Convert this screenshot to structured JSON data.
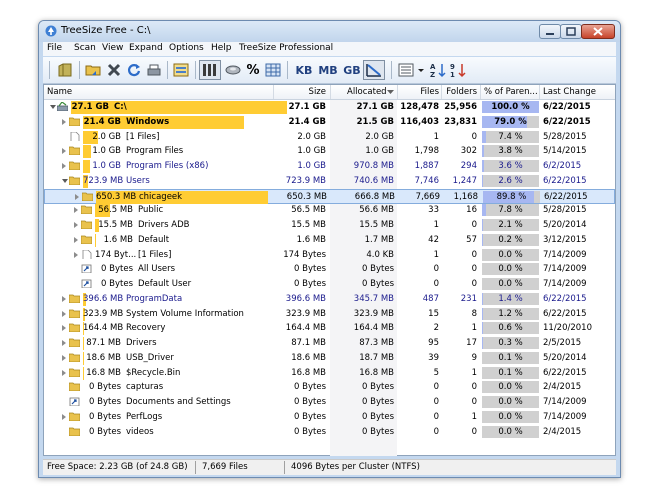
{
  "window": {
    "title": "TreeSize Free - C:\\"
  },
  "menu": [
    "File",
    "Scan",
    "View",
    "Expand",
    "Options",
    "Help",
    "TreeSize Professional"
  ],
  "toolbar": {
    "percent": "%",
    "kb": "KB",
    "mb": "MB",
    "gb": "GB"
  },
  "columns": {
    "name": "Name",
    "size": "Size",
    "allocated": "Allocated",
    "files": "Files",
    "folders": "Folders",
    "percent": "% of Paren...",
    "last_change": "Last Change"
  },
  "colors": {
    "size_bar": "#ffcc33",
    "percent_fill": "#a7b7f1",
    "bold_blue": "#1a1a8c"
  },
  "rows": [
    {
      "indent": 0,
      "exp": "exp",
      "icon": "drive",
      "bar": 1.0,
      "label": "27.1 GB",
      "name": "C:\\",
      "size": "27.1 GB",
      "alloc": "27.1 GB",
      "files": "128,478",
      "folders": "25,956",
      "pct": "100.0 %",
      "pv": 1.0,
      "date": "6/22/2015",
      "bold": true,
      "blue": false
    },
    {
      "indent": 1,
      "exp": "coll",
      "icon": "folder",
      "bar": 0.79,
      "label": "21.4 GB",
      "name": "Windows",
      "size": "21.4 GB",
      "alloc": "21.5 GB",
      "files": "116,403",
      "folders": "23,831",
      "pct": "79.0 %",
      "pv": 0.79,
      "date": "6/22/2015",
      "bold": true,
      "blue": false
    },
    {
      "indent": 1,
      "exp": "none",
      "icon": "file",
      "bar": 0.074,
      "label": "2.0 GB",
      "name": "[1 Files]",
      "size": "2.0 GB",
      "alloc": "2.0 GB",
      "files": "1",
      "folders": "0",
      "pct": "7.4 %",
      "pv": 0.074,
      "date": "5/28/2015",
      "bold": false,
      "blue": false
    },
    {
      "indent": 1,
      "exp": "coll",
      "icon": "folder",
      "bar": 0.038,
      "label": "1.0 GB",
      "name": "Program Files",
      "size": "1.0 GB",
      "alloc": "1.0 GB",
      "files": "1,798",
      "folders": "302",
      "pct": "3.8 %",
      "pv": 0.038,
      "date": "5/14/2015",
      "bold": false,
      "blue": false
    },
    {
      "indent": 1,
      "exp": "coll",
      "icon": "folder",
      "bar": 0.036,
      "label": "1.0 GB",
      "name": "Program Files (x86)",
      "size": "1.0 GB",
      "alloc": "970.8 MB",
      "files": "1,887",
      "folders": "294",
      "pct": "3.6 %",
      "pv": 0.036,
      "date": "6/2/2015",
      "bold": false,
      "blue": true
    },
    {
      "indent": 1,
      "exp": "exp",
      "icon": "folder",
      "bar": 0.026,
      "label": "723.9 MB",
      "name": "Users",
      "size": "723.9 MB",
      "alloc": "740.6 MB",
      "files": "7,746",
      "folders": "1,247",
      "pct": "2.6 %",
      "pv": 0.026,
      "date": "6/22/2015",
      "bold": false,
      "blue": true
    },
    {
      "indent": 2,
      "exp": "coll",
      "icon": "folder",
      "bar": 0.898,
      "label": "650.3 MB",
      "name": "chicageek",
      "size": "650.3 MB",
      "alloc": "666.8 MB",
      "files": "7,669",
      "folders": "1,168",
      "pct": "89.8 %",
      "pv": 0.898,
      "date": "6/22/2015",
      "bold": false,
      "blue": false,
      "sel": true
    },
    {
      "indent": 2,
      "exp": "coll",
      "icon": "folder",
      "bar": 0.078,
      "label": "56.5 MB",
      "name": "Public",
      "size": "56.5 MB",
      "alloc": "56.6 MB",
      "files": "33",
      "folders": "16",
      "pct": "7.8 %",
      "pv": 0.078,
      "date": "5/28/2015",
      "bold": false,
      "blue": false
    },
    {
      "indent": 2,
      "exp": "coll",
      "icon": "folder",
      "bar": 0.021,
      "label": "15.5 MB",
      "name": "Drivers ADB",
      "size": "15.5 MB",
      "alloc": "15.5 MB",
      "files": "1",
      "folders": "0",
      "pct": "2.1 %",
      "pv": 0.021,
      "date": "5/20/2014",
      "bold": false,
      "blue": false
    },
    {
      "indent": 2,
      "exp": "coll",
      "icon": "folder",
      "bar": 0.002,
      "label": "1.6 MB",
      "name": "Default",
      "size": "1.6 MB",
      "alloc": "1.7 MB",
      "files": "42",
      "folders": "57",
      "pct": "0.2 %",
      "pv": 0.002,
      "date": "3/12/2015",
      "bold": false,
      "blue": false
    },
    {
      "indent": 2,
      "exp": "coll",
      "icon": "file",
      "bar": 0.0,
      "label": "174 Byt...",
      "name": "[1 Files]",
      "size": "174 Bytes",
      "alloc": "4.0 KB",
      "files": "1",
      "folders": "0",
      "pct": "0.0 %",
      "pv": 0.0,
      "date": "7/14/2009",
      "bold": false,
      "blue": false
    },
    {
      "indent": 2,
      "exp": "none",
      "icon": "link",
      "bar": 0.0,
      "label": "0 Bytes",
      "name": "All Users",
      "size": "0 Bytes",
      "alloc": "0 Bytes",
      "files": "0",
      "folders": "0",
      "pct": "0.0 %",
      "pv": 0.0,
      "date": "7/14/2009",
      "bold": false,
      "blue": false
    },
    {
      "indent": 2,
      "exp": "none",
      "icon": "link",
      "bar": 0.0,
      "label": "0 Bytes",
      "name": "Default User",
      "size": "0 Bytes",
      "alloc": "0 Bytes",
      "files": "0",
      "folders": "0",
      "pct": "0.0 %",
      "pv": 0.0,
      "date": "7/14/2009",
      "bold": false,
      "blue": false
    },
    {
      "indent": 1,
      "exp": "coll",
      "icon": "folder",
      "bar": 0.014,
      "label": "396.6 MB",
      "name": "ProgramData",
      "size": "396.6 MB",
      "alloc": "345.7 MB",
      "files": "487",
      "folders": "231",
      "pct": "1.4 %",
      "pv": 0.014,
      "date": "6/22/2015",
      "bold": false,
      "blue": true
    },
    {
      "indent": 1,
      "exp": "coll",
      "icon": "folder",
      "bar": 0.012,
      "label": "323.9 MB",
      "name": "System Volume Information",
      "size": "323.9 MB",
      "alloc": "323.9 MB",
      "files": "15",
      "folders": "8",
      "pct": "1.2 %",
      "pv": 0.012,
      "date": "6/22/2015",
      "bold": false,
      "blue": false
    },
    {
      "indent": 1,
      "exp": "coll",
      "icon": "folder",
      "bar": 0.006,
      "label": "164.4 MB",
      "name": "Recovery",
      "size": "164.4 MB",
      "alloc": "164.4 MB",
      "files": "2",
      "folders": "1",
      "pct": "0.6 %",
      "pv": 0.006,
      "date": "11/20/2010",
      "bold": false,
      "blue": false
    },
    {
      "indent": 1,
      "exp": "coll",
      "icon": "folder",
      "bar": 0.003,
      "label": "87.1 MB",
      "name": "Drivers",
      "size": "87.1 MB",
      "alloc": "87.3 MB",
      "files": "95",
      "folders": "17",
      "pct": "0.3 %",
      "pv": 0.003,
      "date": "2/5/2015",
      "bold": false,
      "blue": false
    },
    {
      "indent": 1,
      "exp": "coll",
      "icon": "folder",
      "bar": 0.001,
      "label": "18.6 MB",
      "name": "USB_Driver",
      "size": "18.6 MB",
      "alloc": "18.7 MB",
      "files": "39",
      "folders": "9",
      "pct": "0.1 %",
      "pv": 0.001,
      "date": "5/20/2014",
      "bold": false,
      "blue": false
    },
    {
      "indent": 1,
      "exp": "coll",
      "icon": "folder",
      "bar": 0.001,
      "label": "16.8 MB",
      "name": "$Recycle.Bin",
      "size": "16.8 MB",
      "alloc": "16.8 MB",
      "files": "5",
      "folders": "1",
      "pct": "0.1 %",
      "pv": 0.001,
      "date": "6/22/2015",
      "bold": false,
      "blue": false
    },
    {
      "indent": 1,
      "exp": "none",
      "icon": "folder",
      "bar": 0.0,
      "label": "0 Bytes",
      "name": "capturas",
      "size": "0 Bytes",
      "alloc": "0 Bytes",
      "files": "0",
      "folders": "0",
      "pct": "0.0 %",
      "pv": 0.0,
      "date": "2/4/2015",
      "bold": false,
      "blue": false
    },
    {
      "indent": 1,
      "exp": "none",
      "icon": "link",
      "bar": 0.0,
      "label": "0 Bytes",
      "name": "Documents and Settings",
      "size": "0 Bytes",
      "alloc": "0 Bytes",
      "files": "0",
      "folders": "0",
      "pct": "0.0 %",
      "pv": 0.0,
      "date": "7/14/2009",
      "bold": false,
      "blue": false
    },
    {
      "indent": 1,
      "exp": "coll",
      "icon": "folder",
      "bar": 0.0,
      "label": "0 Bytes",
      "name": "PerfLogs",
      "size": "0 Bytes",
      "alloc": "0 Bytes",
      "files": "0",
      "folders": "1",
      "pct": "0.0 %",
      "pv": 0.0,
      "date": "7/14/2009",
      "bold": false,
      "blue": false
    },
    {
      "indent": 1,
      "exp": "none",
      "icon": "folder",
      "bar": 0.0,
      "label": "0 Bytes",
      "name": "videos",
      "size": "0 Bytes",
      "alloc": "0 Bytes",
      "files": "0",
      "folders": "0",
      "pct": "0.0 %",
      "pv": 0.0,
      "date": "2/4/2015",
      "bold": false,
      "blue": false
    }
  ],
  "status": {
    "free_space": "Free Space: 2.23 GB  (of 24.8 GB)",
    "files": "7,669  Files",
    "cluster": "4096 Bytes per Cluster (NTFS)"
  }
}
